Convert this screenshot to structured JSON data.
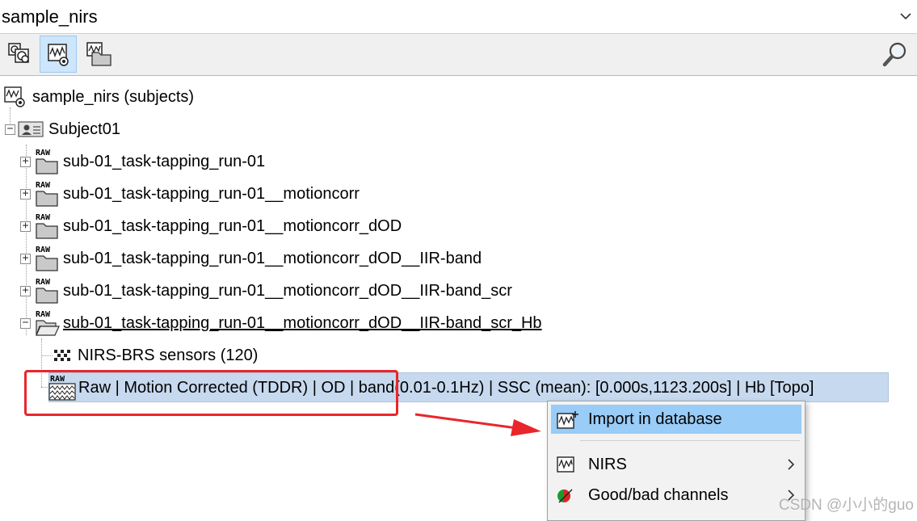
{
  "protocol": {
    "selected": "sample_nirs"
  },
  "toolbar": {
    "buttons": [
      {
        "name": "functional-data-view",
        "icon": "functional-data-icon",
        "active": false
      },
      {
        "name": "anatomy-view",
        "icon": "anatomy-icon",
        "active": true
      },
      {
        "name": "by-condition-view",
        "icon": "condition-folder-icon",
        "active": false
      }
    ],
    "search_icon": "search-icon"
  },
  "tree": {
    "root": {
      "label": "sample_nirs (subjects)",
      "icon": "subjects-icon"
    },
    "subject": {
      "label": "Subject01",
      "expander": "−",
      "icon": "subject-icon"
    },
    "runs": [
      {
        "label": "sub-01_task-tapping_run-01",
        "expander": "+"
      },
      {
        "label": "sub-01_task-tapping_run-01__motioncorr",
        "expander": "+"
      },
      {
        "label": "sub-01_task-tapping_run-01__motioncorr_dOD",
        "expander": "+"
      },
      {
        "label": "sub-01_task-tapping_run-01__motioncorr_dOD__IIR-band",
        "expander": "+"
      },
      {
        "label": "sub-01_task-tapping_run-01__motioncorr_dOD__IIR-band_scr",
        "expander": "+"
      },
      {
        "label": "sub-01_task-tapping_run-01__motioncorr_dOD__IIR-band_scr_Hb",
        "expander": "−"
      }
    ],
    "raw_badge": "RAW",
    "children": [
      {
        "label": "NIRS-BRS sensors (120)",
        "icon": "sensors-icon"
      },
      {
        "label": "Raw | Motion Corrected (TDDR) | OD  | band(0.01-0.1Hz) | SSC (mean): [0.000s,1123.200s] | Hb [Topo]",
        "icon": "raw-data-icon"
      }
    ]
  },
  "context_menu": {
    "items": [
      {
        "label": "Import in database",
        "icon": "import-icon",
        "highlighted": true
      },
      {
        "label": "NIRS",
        "icon": "nirs-icon",
        "submenu": true
      },
      {
        "label": "Good/bad channels",
        "icon": "good-bad-channels-icon",
        "submenu": true
      }
    ]
  },
  "watermark": "CSDN @小小的guo",
  "colors": {
    "selection": "#c7d9ee",
    "menu_highlight": "#99ccf6",
    "annotation_red": "#e8262b"
  }
}
